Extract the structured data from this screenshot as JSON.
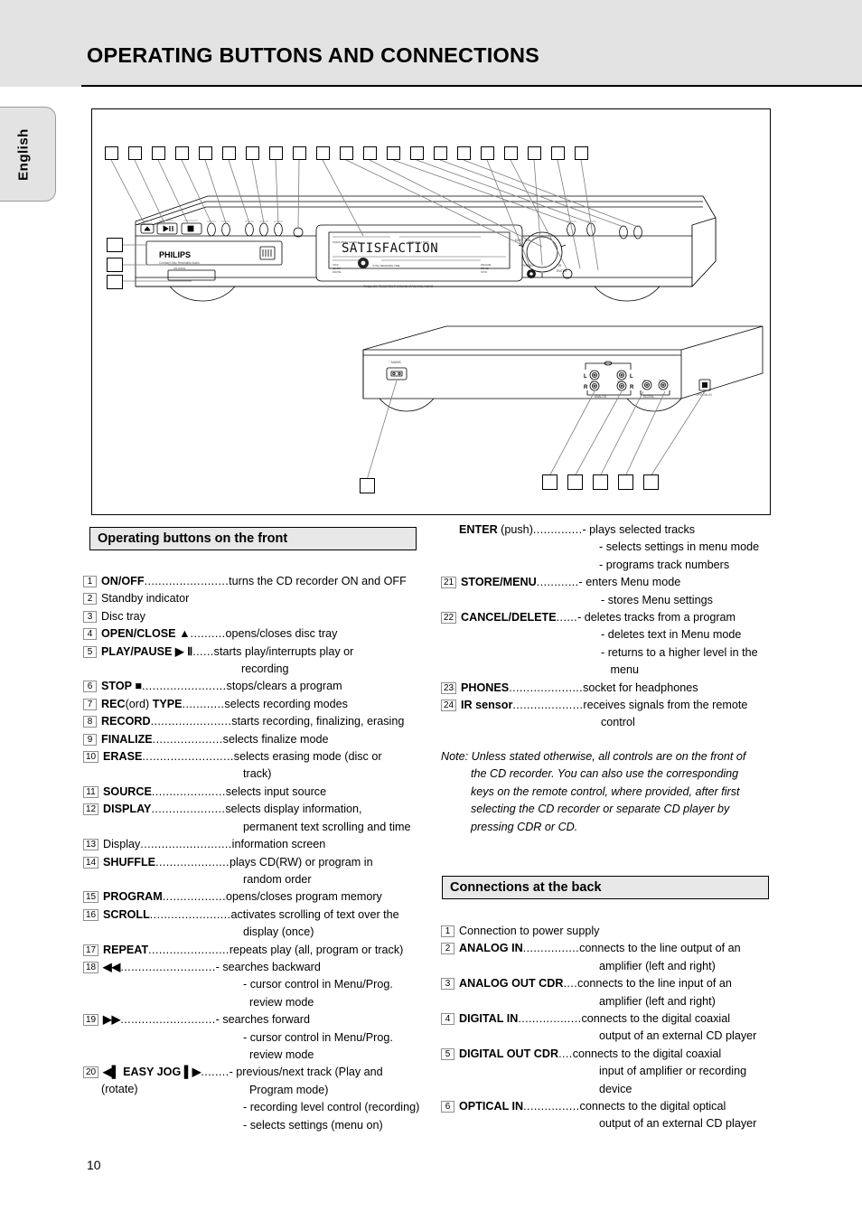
{
  "page": {
    "title": "OPERATING BUTTONS AND CONNECTIONS",
    "language_tab": "English",
    "page_number": "10"
  },
  "figure": {
    "front_view_label": "CD recorder front panel",
    "rear_view_label": "CD recorder rear panel",
    "display_text": "SATISFACTION",
    "brand": "PHILIPS",
    "rear_jack_labels": [
      "L",
      "L",
      "R",
      "R"
    ],
    "front_callout_count": 21,
    "front_side_callout_count": 3,
    "rear_callout_count": 6
  },
  "front_section": {
    "heading": "Operating buttons on the front",
    "items": [
      {
        "num": "1",
        "label": "ON/OFF",
        "bold": true,
        "dots": "........................",
        "desc": "turns the CD recorder ON and OFF",
        "lines": []
      },
      {
        "num": "2",
        "label": "Standby indicator",
        "bold": false,
        "dots": "",
        "desc": "",
        "lines": []
      },
      {
        "num": "3",
        "label": "Disc tray",
        "bold": false,
        "dots": "",
        "desc": "",
        "lines": []
      },
      {
        "num": "4",
        "label": "OPEN/CLOSE ▲",
        "bold": true,
        "dots": "..........",
        "desc": "opens/closes disc tray",
        "lines": []
      },
      {
        "num": "5",
        "label": "PLAY/PAUSE ▶ Ⅱ",
        "bold": true,
        "dots": "......",
        "desc": "starts play/interrupts play or",
        "lines": [
          "recording"
        ]
      },
      {
        "num": "6",
        "label": "STOP ■",
        "bold": true,
        "dots": "........................",
        "desc": "stops/clears a program",
        "lines": []
      },
      {
        "num": "7",
        "label": "REC(ord) TYPE",
        "bold": true,
        "dots": "............",
        "desc": "selects recording modes",
        "lines": []
      },
      {
        "num": "8",
        "label": "RECORD",
        "bold": true,
        "dots": ".......................",
        "desc": "starts recording, finalizing, erasing",
        "lines": []
      },
      {
        "num": "9",
        "label": "FINALIZE",
        "bold": true,
        "dots": "....................",
        "desc": "selects finalize mode",
        "lines": []
      },
      {
        "num": "10",
        "label": "ERASE",
        "bold": true,
        "dots": "..........................",
        "desc": "selects erasing mode (disc or",
        "lines": [
          "track)"
        ]
      },
      {
        "num": "11",
        "label": "SOURCE",
        "bold": true,
        "dots": ".....................",
        "desc": "selects input source",
        "lines": []
      },
      {
        "num": "12",
        "label": "DISPLAY",
        "bold": true,
        "dots": ".....................",
        "desc": "selects display information,",
        "lines": [
          "permanent text scrolling and time"
        ]
      },
      {
        "num": "13",
        "label": "Display",
        "bold": false,
        "dots": "..........................",
        "desc": "information screen",
        "lines": []
      },
      {
        "num": "14",
        "label": "SHUFFLE",
        "bold": true,
        "dots": ".....................",
        "desc": "plays CD(RW) or program in",
        "lines": [
          "random order"
        ]
      },
      {
        "num": "15",
        "label": "PROGRAM",
        "bold": true,
        "dots": "..................",
        "desc": "opens/closes program memory",
        "lines": []
      },
      {
        "num": "16",
        "label": "SCROLL",
        "bold": true,
        "dots": ".......................",
        "desc": "activates scrolling of text over the",
        "lines": [
          "display (once)"
        ]
      },
      {
        "num": "17",
        "label": "REPEAT",
        "bold": true,
        "dots": ".......................",
        "desc": "repeats play (all, program or track)",
        "lines": []
      },
      {
        "num": "18",
        "label": "◀◀",
        "bold": true,
        "dots": "...........................",
        "desc": "- searches backward",
        "lines": [
          "- cursor control in Menu/Prog.",
          "  review mode"
        ]
      },
      {
        "num": "19",
        "label": "▶▶",
        "bold": true,
        "dots": "...........................",
        "desc": "- searches forward",
        "lines": [
          "- cursor control in Menu/Prog.",
          "  review mode"
        ]
      },
      {
        "num": "20",
        "label": "◀▌ EASY JOG ▌▶",
        "sub": "(rotate)",
        "bold": true,
        "dots": "........",
        "desc": "- previous/next track (Play and",
        "lines": [
          "  Program mode)",
          "- recording level control (recording)",
          "- selects settings (menu on)"
        ]
      },
      {
        "num": "",
        "label": "ENTER",
        "suffix": " (push)",
        "bold": true,
        "dots": "..............",
        "desc": "- plays selected tracks",
        "lines": [
          "- selects settings in menu mode",
          "- programs track numbers"
        ]
      },
      {
        "num": "21",
        "label": "STORE/MENU",
        "bold": true,
        "dots": "............",
        "desc": "- enters Menu mode",
        "lines": [
          "- stores Menu settings"
        ]
      },
      {
        "num": "22",
        "label": "CANCEL/DELETE",
        "bold": true,
        "dots": "......",
        "desc": "- deletes tracks from a program",
        "lines": [
          "- deletes text in Menu mode",
          "- returns to a higher level in the",
          "   menu"
        ]
      },
      {
        "num": "23",
        "label": "PHONES",
        "bold": true,
        "dots": ".....................",
        "desc": "socket for headphones",
        "lines": []
      },
      {
        "num": "24",
        "label": "IR sensor",
        "bold": true,
        "dots": "....................",
        "desc": "receives signals from the remote",
        "lines": [
          "control"
        ]
      }
    ],
    "note_prefix": "Note:",
    "note_lines": [
      "Unless stated otherwise, all controls are on the front of",
      "the CD recorder. You can also use the corresponding",
      "keys on the remote control, where provided, after first",
      "selecting the CD recorder or separate CD player by",
      "pressing CDR or CD."
    ]
  },
  "back_section": {
    "heading": "Connections at the back",
    "items": [
      {
        "num": "1",
        "label": "Connection to power supply",
        "bold": false,
        "dots": "",
        "desc": "",
        "lines": []
      },
      {
        "num": "2",
        "label": "ANALOG IN",
        "bold": true,
        "dots": "................",
        "desc": "connects to the line output of an",
        "lines": [
          "amplifier (left and right)"
        ]
      },
      {
        "num": "3",
        "label": "ANALOG OUT CDR",
        "bold": true,
        "dots": "....",
        "desc": "connects to the line input of an",
        "lines": [
          "amplifier (left and right)"
        ]
      },
      {
        "num": "4",
        "label": "DIGITAL IN",
        "bold": true,
        "dots": "..................",
        "desc": "connects to the digital coaxial",
        "lines": [
          "output of an external CD player"
        ]
      },
      {
        "num": "5",
        "label": "DIGITAL OUT CDR",
        "bold": true,
        "dots": "....",
        "desc": "connects to the digital coaxial",
        "lines": [
          "input of amplifier or recording",
          "device"
        ]
      },
      {
        "num": "6",
        "label": "OPTICAL IN",
        "bold": true,
        "dots": "................",
        "desc": "connects to the digital optical",
        "lines": [
          "output of an external CD player"
        ]
      }
    ]
  },
  "colors": {
    "header_band": "#e3e3e3",
    "section_head": "#e8e8e8",
    "leader_line": "#7d7d7d",
    "text": "#000000"
  }
}
